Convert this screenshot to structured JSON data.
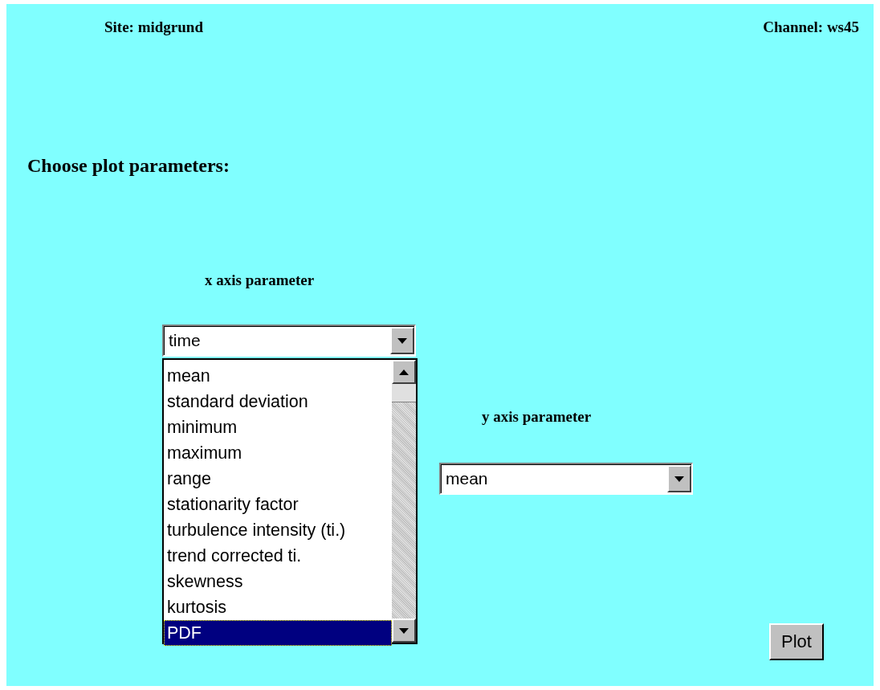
{
  "header": {
    "site": "Site: midgrund",
    "channel": "Channel: ws45"
  },
  "heading": "Choose plot parameters:",
  "x_axis": {
    "label": "x axis parameter",
    "value": "time",
    "expanded": true,
    "options": [
      {
        "label": "mean",
        "selected": false
      },
      {
        "label": "standard deviation",
        "selected": false
      },
      {
        "label": "minimum",
        "selected": false
      },
      {
        "label": "maximum",
        "selected": false
      },
      {
        "label": "range",
        "selected": false
      },
      {
        "label": "stationarity factor",
        "selected": false
      },
      {
        "label": "turbulence intensity (ti.)",
        "selected": false
      },
      {
        "label": "trend corrected ti.",
        "selected": false
      },
      {
        "label": "skewness",
        "selected": false
      },
      {
        "label": "kurtosis",
        "selected": false
      },
      {
        "label": "PDF",
        "selected": true
      }
    ]
  },
  "y_axis": {
    "label": "y axis parameter",
    "value": "mean"
  },
  "plot_button": "Plot"
}
